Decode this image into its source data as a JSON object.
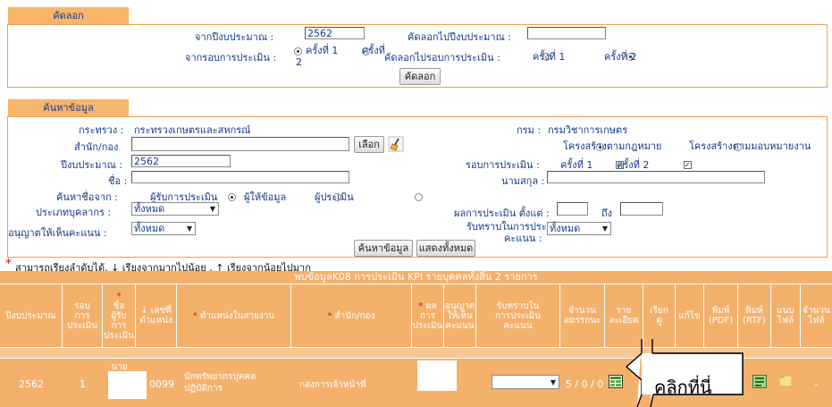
{
  "copy_section": {
    "tab_label": "คัดลอก",
    "from_year_label": "จากปีงบประมาณ :",
    "from_year_value": "2562",
    "to_year_label": "คัดลอกไปปีงบประมาณ :",
    "to_year_value": "",
    "from_round_label": "จากรอบการประเมิน :",
    "round1_label": "ครั้งที่ 1",
    "round_label_partial": "ครั้งที่",
    "round2_wrap": "2",
    "to_round_label": "คัดลอกไปรอบการประเมิน :",
    "to_round1_label": "ครั้งที่ 1",
    "to_round2_label": "ครั้งที่ 2",
    "copy_button": "คัดลอก"
  },
  "search_section": {
    "tab_label": "ค้นหาข้อมูล",
    "ministry_label": "กระทรวง :",
    "ministry_value": "กระทรวงเกษตรและสหกรณ์",
    "department_label": "กรม :",
    "department_value": "กรมวิชาการเกษตร",
    "office_label": "สำนัก/กอง",
    "office_value": "",
    "select_button": "เลือก",
    "structure_law_label": "โครงสร้างตามกฎหมาย",
    "structure_assign_label": "โครงสร้างตามมอบหมายงาน",
    "year_label": "ปีงบประมาณ :",
    "year_value": "2562",
    "round_label": "รอบการประเมิน :",
    "round1_label": "ครั้งที่ 1",
    "round2_label": "ครั้งที่ 2",
    "firstname_label": "ชื่อ :",
    "lastname_label": "นามสกุล :",
    "search_from_label": "ค้นหาชื่อจาก :",
    "search_from_opt1": "ผู้รับการประเมิน",
    "search_from_opt2": "ผู้ให้ข้อมูล",
    "search_from_opt3": "ผู้ประเมิน",
    "personnel_type_label": "ประเภทบุคลากร :",
    "personnel_type_value": "ทั้งหมด",
    "result_label": "ผลการประเมิน ตั้งแต่ :",
    "result_to_label": "ถึง",
    "approve_label": "อนุญาตให้เห็นคะแนน :",
    "approve_value": "ทั้งหมด",
    "ack_label_1": "รับทราบในการประเมิน",
    "ack_label_2": "คะแนน :",
    "ack_value": "ทั้งหมด",
    "search_button": "ค้นหาข้อมูล",
    "show_all_button": "แสดงทั้งหมด"
  },
  "sort_note": "สามารถเรียงลำดับได้, ↓ เรียงจากมากไปน้อย , ↑ เรียงจากน้อยไปมาก",
  "results": {
    "summary": "พบข้อมูลK08 การประเมิน KPI รายบุคคลทั้งสิ้น 2 รายการ",
    "headers": {
      "year": "ปีงบประมาณ",
      "round_1": "รอบ",
      "round_2": "การ",
      "round_3": "ประเมิน",
      "name_1": "ชื่อ",
      "name_2": "ผู้รับ",
      "name_3": "การ",
      "name_4": "ประเมิน",
      "posno_1": "↓ เลขที่",
      "posno_2": "ตำแหน่ง",
      "position": "ตำแหน่งในสายงาน",
      "office": "สำนัก/กอง",
      "result_1": "ผล",
      "result_2": "การ",
      "result_3": "ประเมิน",
      "allow_1": "อนุญาต",
      "allow_2": "ให้เห็น",
      "allow_3": "คะแนน",
      "ack_1": "รับทราบใน",
      "ack_2": "การประเมิน",
      "ack_3": "คะแนน",
      "count_1": "จำนวน",
      "count_2": "สมรรถนะ",
      "detail_1": "ราย",
      "detail_2": "ละเอียด",
      "call_1": "เรียก",
      "call_2": "ดู",
      "edit": "แก้ไข",
      "pdf_1": "พิมพ์",
      "pdf_2": "(PDF)",
      "rtf_1": "พิมพ์",
      "rtf_2": "(RTF)",
      "attach_1": "แนบ",
      "attach_2": "ไฟล์",
      "files_1": "จำนวน",
      "files_2": "ไฟล์"
    },
    "row": {
      "year": "2562",
      "round": "1",
      "name_prefix": "นาย",
      "position_no": "0099",
      "position_1": "นักทรัพยากรบุคคล",
      "position_2": "ปฏิบัติการ",
      "office": "กองการเจ้าหน้าที่",
      "count": "5 / 0 / 0",
      "files": "-"
    }
  },
  "callout": {
    "text": "คลิกที่นี่"
  },
  "colors": {
    "accent": "#f6b56b",
    "row": "#f4b16c",
    "text": "#123a8a",
    "required": "#e01010"
  }
}
